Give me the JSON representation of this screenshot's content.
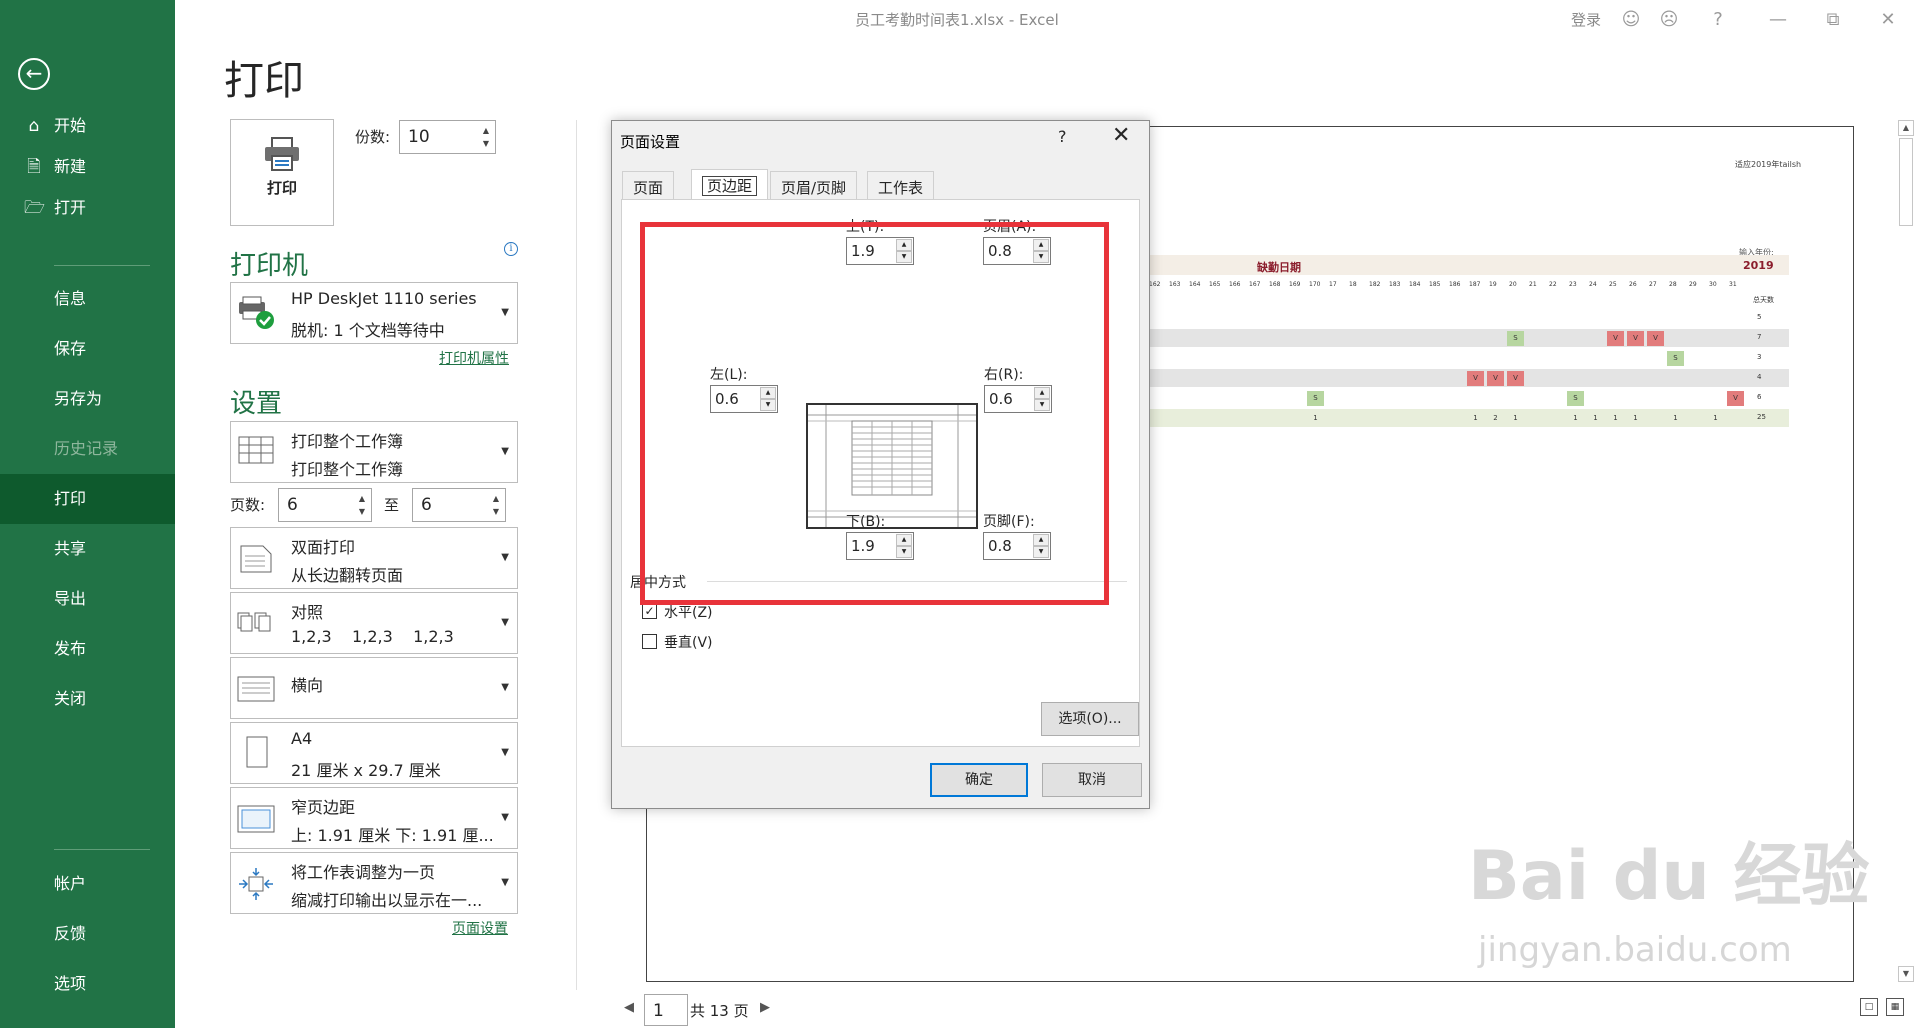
{
  "window": {
    "title": "员工考勤时间表1.xlsx  -  Excel",
    "signin": "登录"
  },
  "nav": {
    "items": [
      "开始",
      "新建",
      "打开",
      "信息",
      "保存",
      "另存为",
      "历史记录",
      "打印",
      "共享",
      "导出",
      "发布",
      "关闭",
      "帐户",
      "反馈",
      "选项"
    ],
    "selected": "打印"
  },
  "print": {
    "page_title": "打印",
    "print_button": "打印",
    "copies_label": "份数:",
    "copies_value": "10",
    "printer_header": "打印机",
    "printer_name": "HP DeskJet 1110 series",
    "printer_status": "脱机: 1 个文档等待中",
    "printer_props_link": "打印机属性",
    "settings_header": "设置",
    "what_l1": "打印整个工作簿",
    "what_l2": "打印整个工作簿",
    "pages_label": "页数:",
    "pages_from": "6",
    "pages_to_label": "至",
    "pages_to": "6",
    "duplex_l1": "双面打印",
    "duplex_l2": "从长边翻转页面",
    "collate_l1": "对照",
    "collate_l2": "1,2,3    1,2,3    1,2,3",
    "orientation": "横向",
    "paper_l1": "A4",
    "paper_l2": "21 厘米 x 29.7 厘米",
    "margins_l1": "窄页边距",
    "margins_l2": "上: 1.91 厘米 下: 1.91 厘...",
    "scale_l1": "将工作表调整为一页",
    "scale_l2": "缩减打印输出以显示在一...",
    "page_setup_link": "页面设置"
  },
  "preview": {
    "header_right": "适应2019年tailsh",
    "banner_title": "缺勤日期",
    "year_label": "输入年份:",
    "year_value": "2019",
    "total_label": "总天数",
    "day_numbers": [
      "162",
      "163",
      "164",
      "165",
      "166",
      "167",
      "168",
      "169",
      "170",
      "17",
      "18",
      "182",
      "183",
      "184",
      "185",
      "186",
      "187",
      "19",
      "20",
      "21",
      "22",
      "23",
      "24",
      "25",
      "26",
      "27",
      "28",
      "29",
      "30",
      "31"
    ],
    "rows": [
      {
        "marks": [],
        "total": "5"
      },
      {
        "marks": [
          [
            "S",
            18
          ],
          [
            "V",
            23
          ],
          [
            "V",
            24
          ],
          [
            "V",
            25
          ]
        ],
        "total": "7"
      },
      {
        "marks": [
          [
            "S",
            26
          ]
        ],
        "total": "3"
      },
      {
        "marks": [
          [
            "V",
            16
          ],
          [
            "V",
            17
          ],
          [
            "V",
            18
          ]
        ],
        "total": "4"
      },
      {
        "marks": [
          [
            "S",
            8
          ],
          [
            "S",
            21
          ],
          [
            "V",
            29
          ]
        ],
        "total": "6"
      }
    ],
    "sum_row": [
      [
        "1",
        8
      ],
      [
        "1",
        16
      ],
      [
        "2",
        17
      ],
      [
        "1",
        18
      ],
      [
        "1",
        21
      ],
      [
        "1",
        22
      ],
      [
        "1",
        23
      ],
      [
        "1",
        24
      ],
      [
        "1",
        26
      ],
      [
        "1",
        28
      ]
    ],
    "sum_total": "25",
    "pager_value": "1",
    "pager_total": "共 13 页"
  },
  "dialog": {
    "title": "页面设置",
    "help": "?",
    "tabs": [
      "页面",
      "页边距",
      "页眉/页脚",
      "工作表"
    ],
    "active_tab": "页边距",
    "top_label": "上(T):",
    "top_value": "1.9",
    "header_label": "页眉(A):",
    "header_value": "0.8",
    "left_label": "左(L):",
    "left_value": "0.6",
    "right_label": "右(R):",
    "right_value": "0.6",
    "bottom_label": "下(B):",
    "bottom_value": "1.9",
    "footer_label": "页脚(F):",
    "footer_value": "0.8",
    "center_group": "居中方式",
    "horizontal": "水平(Z)",
    "horizontal_checked": true,
    "vertical": "垂直(V)",
    "vertical_checked": false,
    "options_button": "选项(O)...",
    "ok": "确定",
    "cancel": "取消"
  },
  "watermark": {
    "logo": "Bai du 经验",
    "url": "jingyan.baidu.com"
  },
  "colors": {
    "excel_green": "#217346",
    "nav_selected": "#0e5a2d",
    "highlight_red": "#e8333a"
  }
}
